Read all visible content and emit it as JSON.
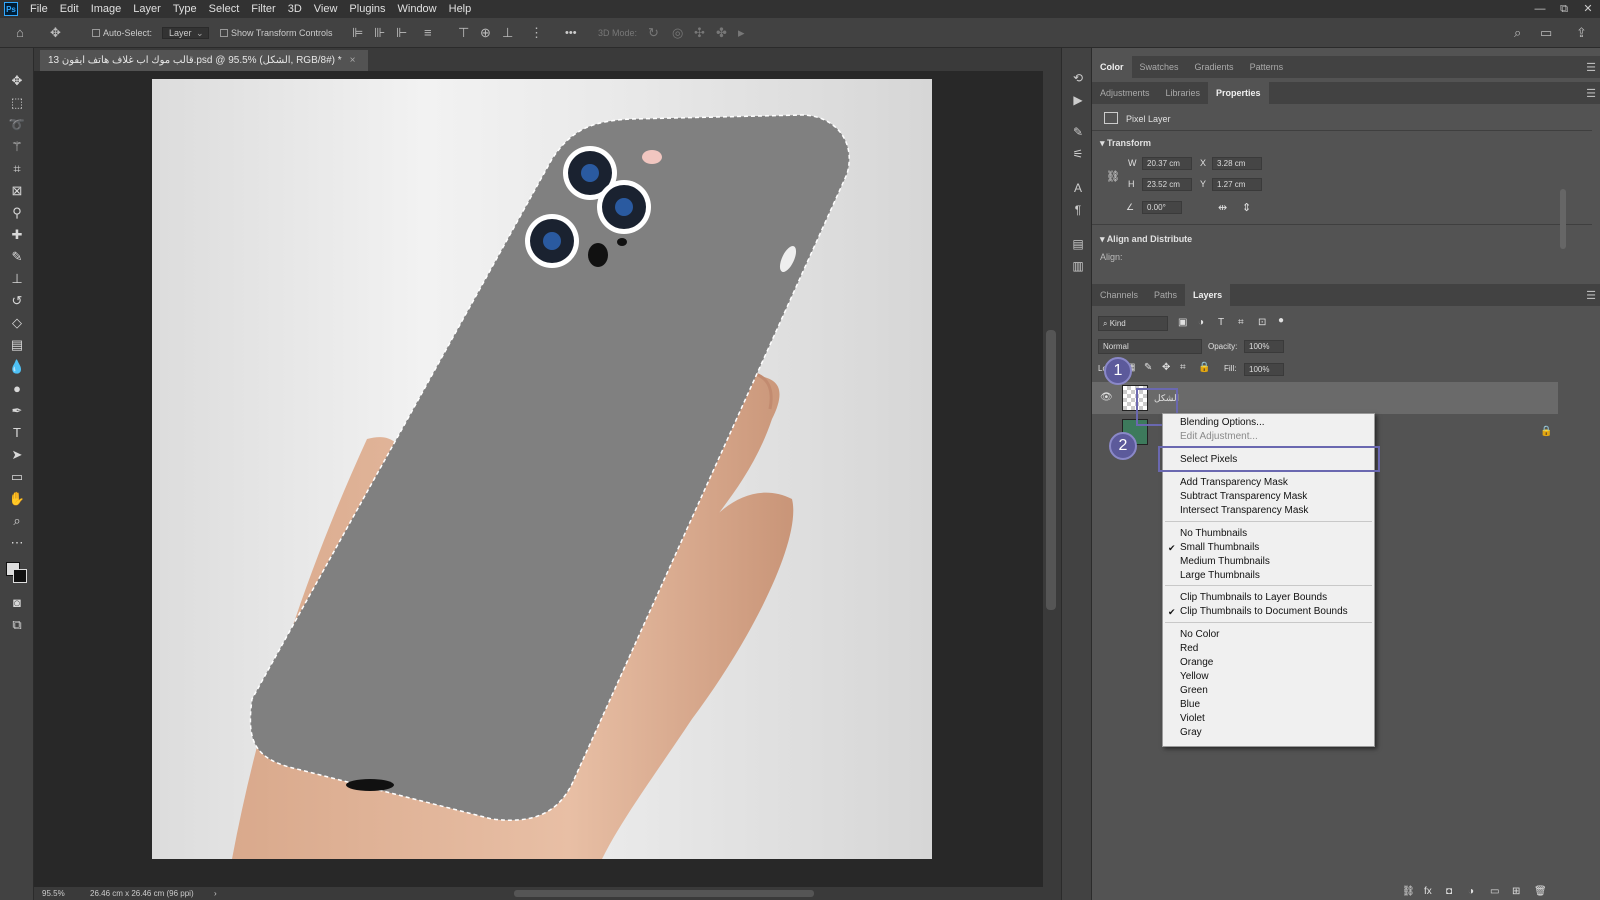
{
  "app": {
    "logo": "Ps"
  },
  "menubar": {
    "items": [
      "File",
      "Edit",
      "Image",
      "Layer",
      "Type",
      "Select",
      "Filter",
      "3D",
      "View",
      "Plugins",
      "Window",
      "Help"
    ]
  },
  "window_controls": [
    "—",
    "⧉",
    "✕"
  ],
  "options_bar": {
    "auto_select_label": "Auto-Select:",
    "auto_select_value": "Layer",
    "show_transform_label": "Show Transform Controls",
    "three_d_mode_label": "3D Mode:",
    "more_label": "•••"
  },
  "document": {
    "tab_title": "قالب موك اب غلاف هاتف ايفون 13.psd @ 95.5% (الشكل, RGB/8#) *",
    "close_glyph": "×"
  },
  "status": {
    "zoom": "95.5%",
    "doc_size": "26.46 cm x 26.46 cm (96 ppi)",
    "arrow": "›"
  },
  "panels": {
    "top_tabs": [
      "Color",
      "Swatches",
      "Gradients",
      "Patterns"
    ],
    "top_active": "Color",
    "second_tabs": [
      "Adjustments",
      "Libraries",
      "Properties"
    ],
    "second_active": "Properties",
    "properties": {
      "layer_type": "Pixel Layer",
      "transform_title": "Transform",
      "w_label": "W",
      "w_value": "20.37 cm",
      "x_label": "X",
      "x_value": "3.28 cm",
      "h_label": "H",
      "h_value": "23.52 cm",
      "y_label": "Y",
      "y_value": "1.27 cm",
      "angle_value": "0.00°",
      "align_title": "Align and Distribute",
      "align_label": "Align:"
    },
    "layers_tabs": [
      "Channels",
      "Paths",
      "Layers"
    ],
    "layers_active": "Layers",
    "layers": {
      "filter_kind": "Kind",
      "blend_mode": "Normal",
      "opacity_label": "Opacity:",
      "opacity_value": "100%",
      "lock_label": "Lock:",
      "fill_label": "Fill:",
      "fill_value": "100%",
      "layer_name": "الشكل"
    }
  },
  "annotations": {
    "badge1": "1",
    "badge2": "2"
  },
  "context_menu": {
    "items": [
      {
        "label": "Blending Options...",
        "enabled": true,
        "checked": false
      },
      {
        "label": "Edit Adjustment...",
        "enabled": false,
        "checked": false
      },
      {
        "label": "Select Pixels",
        "enabled": true,
        "checked": false
      },
      {
        "label": "Add Transparency Mask",
        "enabled": true,
        "checked": false
      },
      {
        "label": "Subtract Transparency Mask",
        "enabled": true,
        "checked": false
      },
      {
        "label": "Intersect Transparency Mask",
        "enabled": true,
        "checked": false
      },
      {
        "label": "No Thumbnails",
        "enabled": true,
        "checked": false
      },
      {
        "label": "Small Thumbnails",
        "enabled": true,
        "checked": true
      },
      {
        "label": "Medium Thumbnails",
        "enabled": true,
        "checked": false
      },
      {
        "label": "Large Thumbnails",
        "enabled": true,
        "checked": false
      },
      {
        "label": "Clip Thumbnails to Layer Bounds",
        "enabled": true,
        "checked": false
      },
      {
        "label": "Clip Thumbnails to Document Bounds",
        "enabled": true,
        "checked": true
      },
      {
        "label": "No Color",
        "enabled": true,
        "checked": false
      },
      {
        "label": "Red",
        "enabled": true,
        "checked": false
      },
      {
        "label": "Orange",
        "enabled": true,
        "checked": false
      },
      {
        "label": "Yellow",
        "enabled": true,
        "checked": false
      },
      {
        "label": "Green",
        "enabled": true,
        "checked": false
      },
      {
        "label": "Blue",
        "enabled": true,
        "checked": false
      },
      {
        "label": "Violet",
        "enabled": true,
        "checked": false
      },
      {
        "label": "Gray",
        "enabled": true,
        "checked": false
      }
    ]
  },
  "colors": {
    "ui_dark": "#323232",
    "panel": "#535353",
    "accent_highlight": "#6a68b0",
    "phone_gray": "#808080"
  }
}
